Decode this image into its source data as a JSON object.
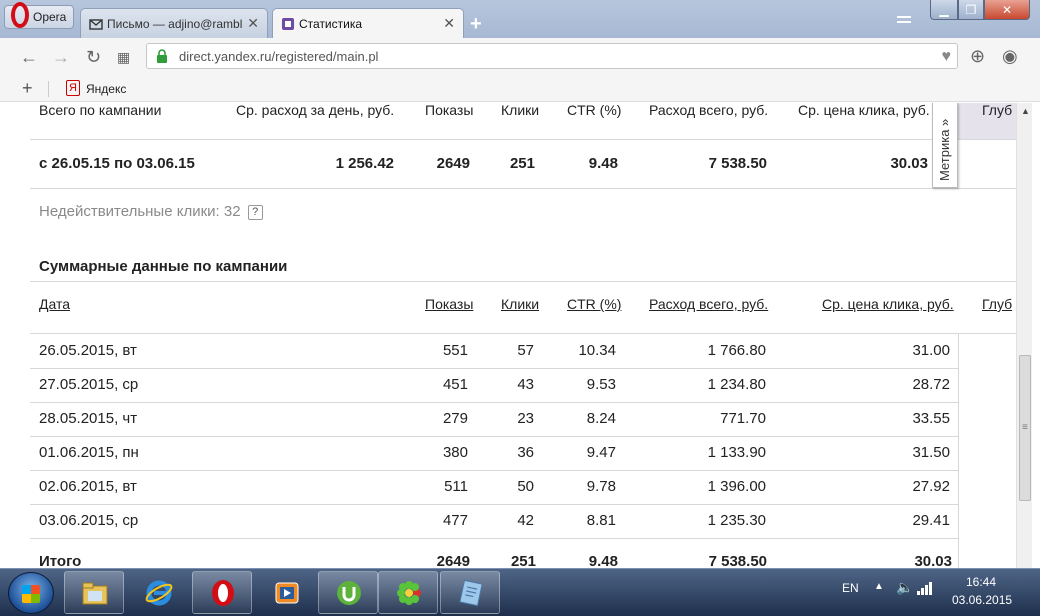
{
  "browser": {
    "menu_label": "Opera",
    "tabs": [
      {
        "label": "Письмо — adjino@rambl",
        "icon": "mail-icon",
        "active": false
      },
      {
        "label": "Статистика",
        "icon": "stats-page-icon",
        "active": true
      }
    ],
    "new_tab": "+",
    "url": "direct.yandex.ru/registered/main.pl",
    "bookmarks_add": "+",
    "bookmarks": [
      {
        "label": "Яндекс",
        "icon": "yandex-icon",
        "badge": "Я"
      }
    ]
  },
  "summary": {
    "headers": {
      "period": "Всего по кампании",
      "avg_daily": "Ср. расход за день, руб.",
      "shows": "Показы",
      "clicks": "Клики",
      "ctr": "CTR (%)",
      "total": "Расход всего, руб.",
      "avg_click": "Ср. цена клика, руб.",
      "depth": "Глуб"
    },
    "row": {
      "period": "с 26.05.15 по 03.06.15",
      "avg_daily": "1 256.42",
      "shows": "2649",
      "clicks": "251",
      "ctr": "9.48",
      "total": "7 538.50",
      "avg_click": "30.03"
    },
    "invalid_clicks_label": "Недействительные клики: 32",
    "help_badge": "?"
  },
  "metrika": {
    "label": "Метрика »"
  },
  "daily": {
    "title": "Суммарные данные по кампании",
    "headers": {
      "date": "Дата",
      "shows": "Показы",
      "clicks": "Клики",
      "ctr": "CTR (%)",
      "total": "Расход всего, руб.",
      "avg_click": "Ср. цена клика, руб.",
      "depth": "Глуб"
    },
    "rows": [
      {
        "date": "26.05.2015, вт",
        "shows": "551",
        "clicks": "57",
        "ctr": "10.34",
        "total": "1 766.80",
        "avg_click": "31.00"
      },
      {
        "date": "27.05.2015, ср",
        "shows": "451",
        "clicks": "43",
        "ctr": "9.53",
        "total": "1 234.80",
        "avg_click": "28.72"
      },
      {
        "date": "28.05.2015, чт",
        "shows": "279",
        "clicks": "23",
        "ctr": "8.24",
        "total": "771.70",
        "avg_click": "33.55"
      },
      {
        "date": "01.06.2015, пн",
        "shows": "380",
        "clicks": "36",
        "ctr": "9.47",
        "total": "1 133.90",
        "avg_click": "31.50"
      },
      {
        "date": "02.06.2015, вт",
        "shows": "511",
        "clicks": "50",
        "ctr": "9.78",
        "total": "1 396.00",
        "avg_click": "27.92"
      },
      {
        "date": "03.06.2015, ср",
        "shows": "477",
        "clicks": "42",
        "ctr": "8.81",
        "total": "1 235.30",
        "avg_click": "29.41"
      }
    ],
    "total_row": {
      "label": "Итого",
      "shows": "2649",
      "clicks": "251",
      "ctr": "9.48",
      "total": "7 538.50",
      "avg_click": "30.03"
    }
  },
  "taskbar": {
    "items": [
      "explorer-icon",
      "ie-icon",
      "opera-icon",
      "media-player-icon",
      "utorrent-icon",
      "icq-icon",
      "notepad-icon"
    ],
    "language": "EN",
    "time": "16:44",
    "date": "03.06.2015"
  },
  "colors": {
    "opera_red": "#d20d16",
    "header_shade": "#e6e2ec",
    "taskbar": "#1e2f4c"
  }
}
